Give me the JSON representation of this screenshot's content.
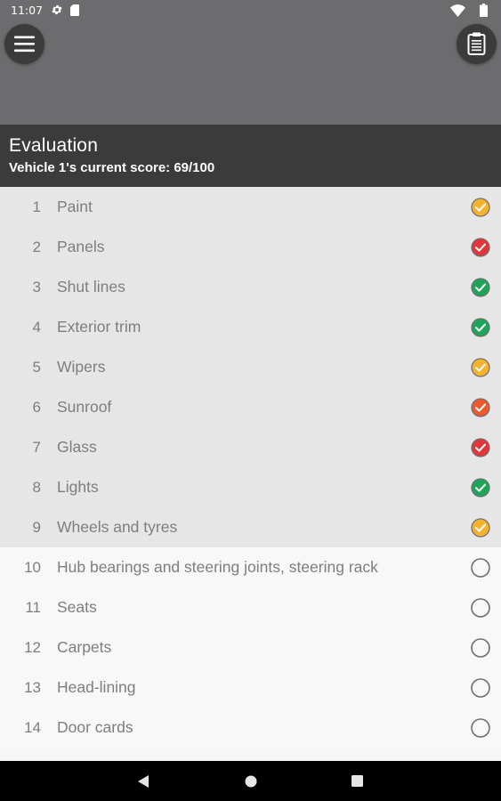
{
  "status_bar": {
    "time": "11:07",
    "icons": [
      "gear-icon",
      "sd-card-icon",
      "wifi-icon",
      "battery-icon"
    ]
  },
  "toolbar": {
    "menu_icon": "hamburger-menu-icon",
    "clipboard_icon": "clipboard-icon"
  },
  "header": {
    "title": "Evaluation",
    "score_text": "Vehicle 1's current score: 69/100"
  },
  "colors": {
    "amber": "#f4b22e",
    "red": "#e2373a",
    "green": "#1fa55a",
    "orange": "#ec5a2f",
    "unset_ring": "#6e6e6e"
  },
  "items": [
    {
      "num": "1",
      "label": "Paint",
      "status": "amber"
    },
    {
      "num": "2",
      "label": "Panels",
      "status": "red"
    },
    {
      "num": "3",
      "label": "Shut lines",
      "status": "green"
    },
    {
      "num": "4",
      "label": "Exterior trim",
      "status": "green"
    },
    {
      "num": "5",
      "label": "Wipers",
      "status": "amber"
    },
    {
      "num": "6",
      "label": "Sunroof",
      "status": "orange"
    },
    {
      "num": "7",
      "label": "Glass",
      "status": "red"
    },
    {
      "num": "8",
      "label": "Lights",
      "status": "green"
    },
    {
      "num": "9",
      "label": "Wheels and tyres",
      "status": "amber"
    },
    {
      "num": "10",
      "label": "Hub bearings and steering joints, steering rack",
      "status": "unset"
    },
    {
      "num": "11",
      "label": "Seats",
      "status": "unset"
    },
    {
      "num": "12",
      "label": "Carpets",
      "status": "unset"
    },
    {
      "num": "13",
      "label": "Head-lining",
      "status": "unset"
    },
    {
      "num": "14",
      "label": "Door cards",
      "status": "unset"
    }
  ],
  "nav": {
    "back_icon": "back-triangle-icon",
    "home_icon": "home-circle-icon",
    "recent_icon": "recents-square-icon"
  }
}
